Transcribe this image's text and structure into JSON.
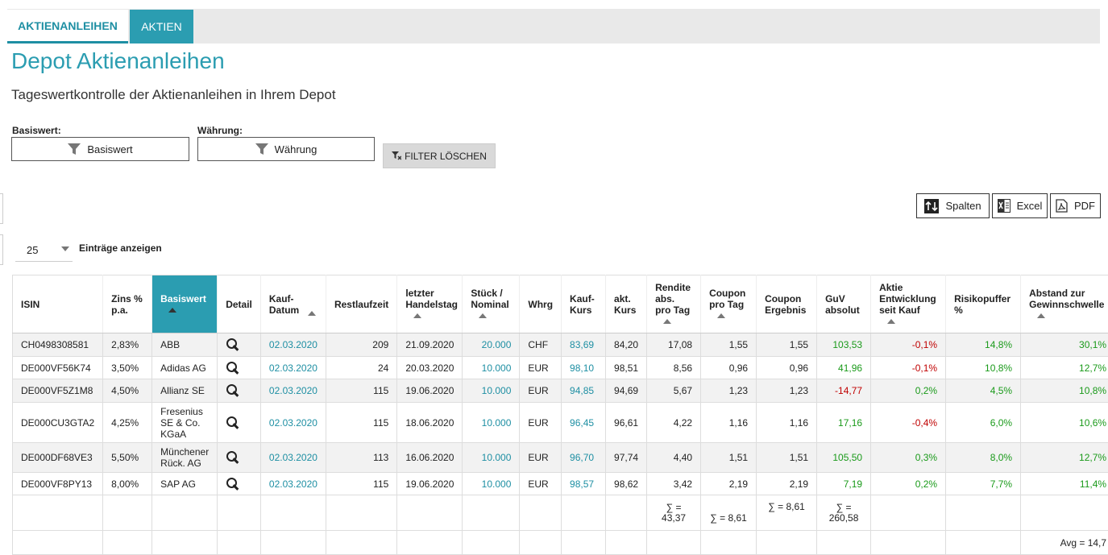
{
  "tabs": [
    {
      "label": "AKTIENANLEIHEN"
    },
    {
      "label": "AKTIEN"
    }
  ],
  "title": "Depot Aktienanleihen",
  "subtitle": "Tageswertkontrolle der Aktienanleihen in Ihrem Depot",
  "filters": {
    "basiswert_label": "Basiswert:",
    "basiswert_button": "Basiswert",
    "waehrung_label": "Währung:",
    "waehrung_button": "Währung",
    "clear": "FILTER LÖSCHEN"
  },
  "export": {
    "columns": "Spalten",
    "excel": "Excel",
    "pdf": "PDF"
  },
  "paging": {
    "size": "25",
    "label": "Einträge anzeigen"
  },
  "headers": [
    "ISIN",
    "Zins % p.a.",
    "Basiswert",
    "Detail",
    "Kauf-Datum",
    "Restlaufzeit",
    "letzter Handelstag",
    "Stück / Nominal",
    "Whrg",
    "Kauf-Kurs",
    "akt. Kurs",
    "Rendite abs. pro Tag",
    "Coupon pro Tag",
    "Coupon Ergebnis",
    "GuV absolut",
    "Aktie Entwicklung seit Kauf",
    "Risikopuffer %",
    "Abstand zur Gewinnschwelle"
  ],
  "rows": [
    [
      "CH0498308581",
      "2,83%",
      "ABB",
      "02.03.2020",
      "209",
      "21.09.2020",
      "20.000",
      "CHF",
      "83,69",
      "84,20",
      "17,08",
      "1,55",
      "1,55",
      "103,53",
      "-0,1%",
      "14,8%",
      "30,1%"
    ],
    [
      "DE000VF56K74",
      "3,50%",
      "Adidas AG",
      "02.03.2020",
      "24",
      "20.03.2020",
      "10.000",
      "EUR",
      "98,10",
      "98,51",
      "8,56",
      "0,96",
      "0,96",
      "41,96",
      "-0,1%",
      "10,8%",
      "12,7%"
    ],
    [
      "DE000VF5Z1M8",
      "4,50%",
      "Allianz SE",
      "02.03.2020",
      "115",
      "19.06.2020",
      "10.000",
      "EUR",
      "94,85",
      "94,69",
      "5,67",
      "1,23",
      "1,23",
      "-14,77",
      "0,2%",
      "4,5%",
      "10,8%"
    ],
    [
      "DE000CU3GTA2",
      "4,25%",
      "Fresenius SE & Co. KGaA",
      "02.03.2020",
      "115",
      "18.06.2020",
      "10.000",
      "EUR",
      "96,45",
      "96,61",
      "4,22",
      "1,16",
      "1,16",
      "17,16",
      "-0,4%",
      "6,0%",
      "10,6%"
    ],
    [
      "DE000DF68VE3",
      "5,50%",
      "Münchener Rück. AG",
      "02.03.2020",
      "113",
      "16.06.2020",
      "10.000",
      "EUR",
      "96,70",
      "97,74",
      "4,40",
      "1,51",
      "1,51",
      "105,50",
      "0,3%",
      "8,0%",
      "12,7%"
    ],
    [
      "DE000VF8PY13",
      "8,00%",
      "SAP AG",
      "02.03.2020",
      "115",
      "19.06.2020",
      "10.000",
      "EUR",
      "98,57",
      "98,62",
      "3,42",
      "2,19",
      "2,19",
      "7,19",
      "0,2%",
      "7,7%",
      "11,4%"
    ]
  ],
  "sums": {
    "rendite": "∑ = 43,37",
    "coupon_tag": "∑ = 8,61",
    "coupon_ergebnis": "∑ = 8,61",
    "guv": "∑ = 260,58",
    "avg": "Avg = 14,7"
  }
}
